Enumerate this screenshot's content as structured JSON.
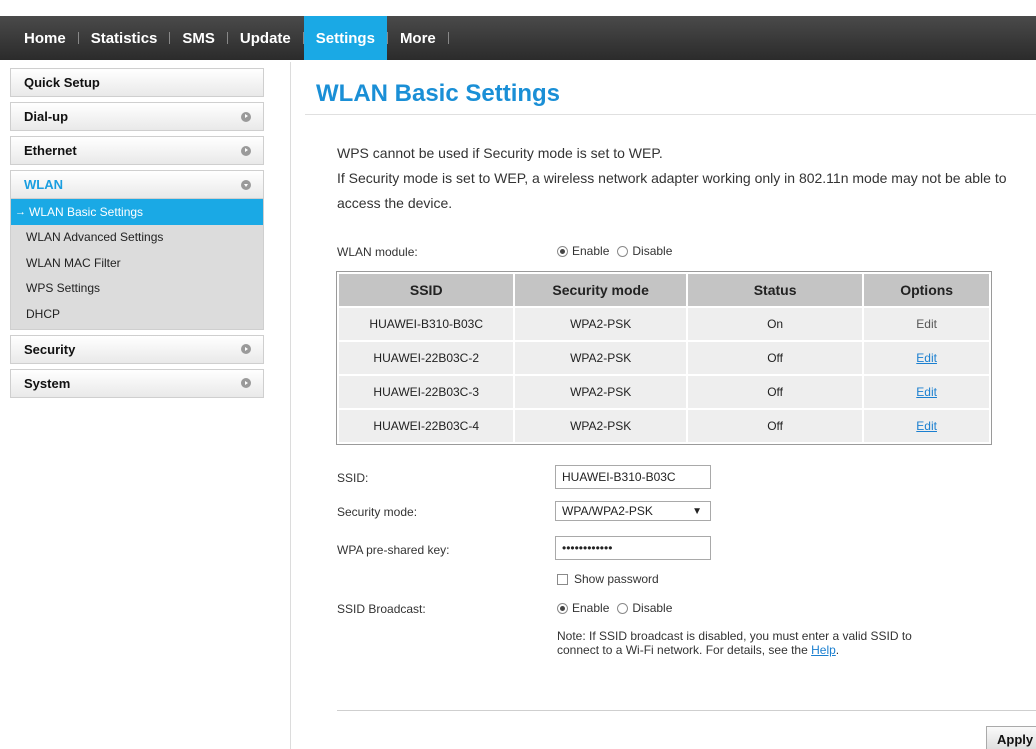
{
  "nav": {
    "items": [
      {
        "label": "Home",
        "active": false
      },
      {
        "label": "Statistics",
        "active": false
      },
      {
        "label": "SMS",
        "active": false
      },
      {
        "label": "Update",
        "active": false
      },
      {
        "label": "Settings",
        "active": true
      },
      {
        "label": "More",
        "active": false
      }
    ],
    "accent_color": "#1aa9e5"
  },
  "sidebar": {
    "quick_setup": "Quick Setup",
    "dialup": "Dial-up",
    "ethernet": "Ethernet",
    "wlan": "WLAN",
    "wlan_items": [
      "WLAN Basic Settings",
      "WLAN Advanced Settings",
      "WLAN MAC Filter",
      "WPS Settings",
      "DHCP"
    ],
    "security": "Security",
    "system": "System",
    "active_arrow": "→"
  },
  "main": {
    "title": "WLAN Basic Settings",
    "intro_line1": "WPS cannot be used if Security mode is set to WEP.",
    "intro_line2": "If Security mode is set to WEP, a wireless network adapter working only in 802.11n mode may not be able to access the device.",
    "wlan_module_label": "WLAN module:",
    "enable_label": "Enable",
    "disable_label": "Disable",
    "table": {
      "headers": [
        "SSID",
        "Security mode",
        "Status",
        "Options"
      ],
      "rows": [
        {
          "ssid": "HUAWEI-B310-B03C",
          "security": "WPA2-PSK",
          "status": "On",
          "option": "Edit"
        },
        {
          "ssid": "HUAWEI-22B03C-2",
          "security": "WPA2-PSK",
          "status": "Off",
          "option": "Edit"
        },
        {
          "ssid": "HUAWEI-22B03C-3",
          "security": "WPA2-PSK",
          "status": "Off",
          "option": "Edit"
        },
        {
          "ssid": "HUAWEI-22B03C-4",
          "security": "WPA2-PSK",
          "status": "Off",
          "option": "Edit"
        }
      ]
    },
    "ssid_label": "SSID:",
    "ssid_value": "HUAWEI-B310-B03C",
    "security_mode_label": "Security mode:",
    "security_mode_value": "WPA/WPA2-PSK",
    "dropdown_arrow": "▼",
    "psk_label": "WPA pre-shared key:",
    "psk_value": "••••••••••••",
    "show_password_label": "Show password",
    "ssid_broadcast_label": "SSID Broadcast:",
    "note_text": "Note: If SSID broadcast is disabled, you must enter a valid SSID to connect to a Wi-Fi network. For details, see the ",
    "help_link": "Help",
    "note_end": ".",
    "apply_label": "Apply"
  }
}
